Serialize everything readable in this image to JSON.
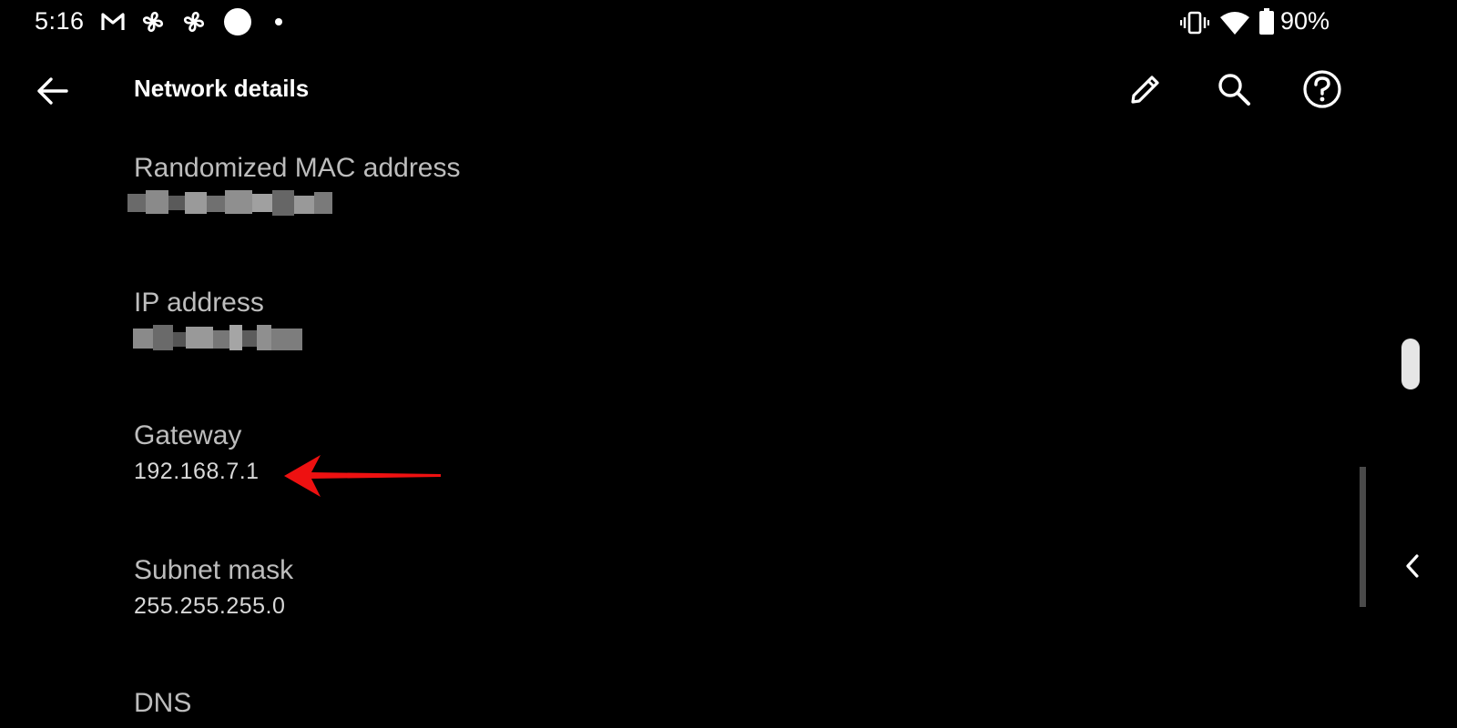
{
  "status_bar": {
    "time": "5:16",
    "battery_percent": "90%",
    "notification_icons": [
      "gmail-icon",
      "pinwheel-icon",
      "pinwheel-icon",
      "circle-icon",
      "dot-icon"
    ],
    "system_icons": [
      "vibrate-icon",
      "wifi-icon",
      "battery-icon"
    ]
  },
  "toolbar": {
    "title": "Network details",
    "actions": [
      "edit-icon",
      "search-icon",
      "help-icon"
    ]
  },
  "details": [
    {
      "label": "Randomized MAC address",
      "value": "",
      "redacted": true
    },
    {
      "label": "IP address",
      "value": "",
      "redacted": true
    },
    {
      "label": "Gateway",
      "value": "192.168.7.1",
      "redacted": false
    },
    {
      "label": "Subnet mask",
      "value": "255.255.255.0",
      "redacted": false
    },
    {
      "label": "DNS",
      "value": "",
      "redacted": false
    }
  ],
  "colors": {
    "background": "#000000",
    "text_primary": "#ffffff",
    "text_label": "#bdbdbd",
    "annotation": "#ee1111"
  }
}
